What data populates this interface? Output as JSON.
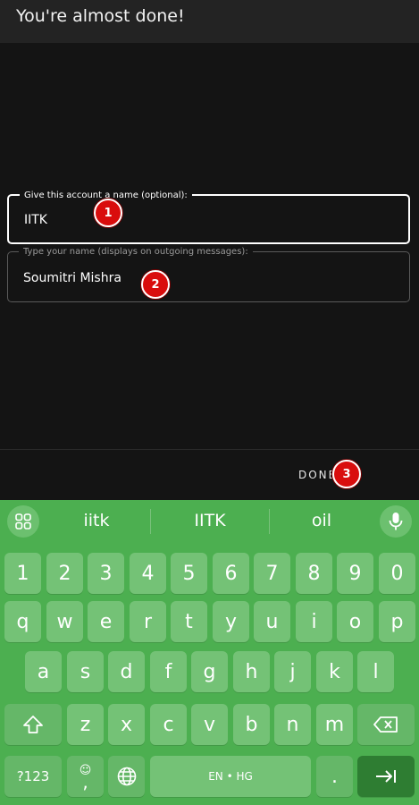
{
  "header": {
    "title": "You're almost done!"
  },
  "form": {
    "account_name": {
      "label": "Give this account a name (optional):",
      "value": "IITK"
    },
    "your_name": {
      "label": "Type your name (displays on outgoing messages):",
      "value": "Soumitri Mishra"
    }
  },
  "markers": [
    "1",
    "2",
    "3"
  ],
  "actions": {
    "done_label": "DONE"
  },
  "keyboard": {
    "suggestions": [
      "iitk",
      "IITK",
      "oil"
    ],
    "number_row": [
      "1",
      "2",
      "3",
      "4",
      "5",
      "6",
      "7",
      "8",
      "9",
      "0"
    ],
    "row1": [
      "q",
      "w",
      "e",
      "r",
      "t",
      "y",
      "u",
      "i",
      "o",
      "p"
    ],
    "row2": [
      "a",
      "s",
      "d",
      "f",
      "g",
      "h",
      "j",
      "k",
      "l"
    ],
    "row3": [
      "z",
      "x",
      "c",
      "v",
      "b",
      "n",
      "m"
    ],
    "symbols_label": "?123",
    "comma_label": ",",
    "emoji_glyph": "☺",
    "space_label": "EN • HG",
    "period_label": "."
  },
  "colors": {
    "keyboard_bg": "#4caf50",
    "key_bg": "#74c276",
    "enter_key_bg": "#2e7d32",
    "marker_red": "#d90d0d"
  },
  "icons": [
    "apps-grid-icon",
    "microphone-icon",
    "shift-icon",
    "backspace-icon",
    "globe-icon",
    "enter-tab-icon"
  ]
}
